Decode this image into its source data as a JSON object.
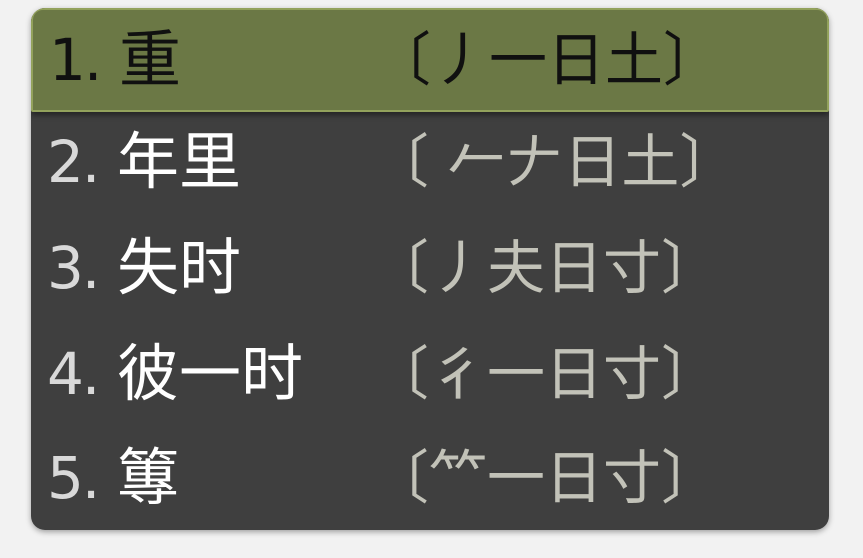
{
  "candidates": [
    {
      "number": "1.",
      "word": "重",
      "code": "〔丿一日土〕",
      "selected": true
    },
    {
      "number": "2.",
      "word": "年里",
      "code": "〔 𠂉𠂇日土〕"
    },
    {
      "number": "3.",
      "word": "失时",
      "code": "〔丿夫日寸〕"
    },
    {
      "number": "4.",
      "word": "彼一时",
      "code": "〔彳一日寸〕"
    },
    {
      "number": "5.",
      "word": "篿",
      "code": "〔⺮一日寸〕"
    }
  ],
  "colors": {
    "panel_bg": "#3f3f3f",
    "selected_bg": "#6b7845",
    "text": "#d9d9d9",
    "code_text": "#c2c2b8"
  }
}
